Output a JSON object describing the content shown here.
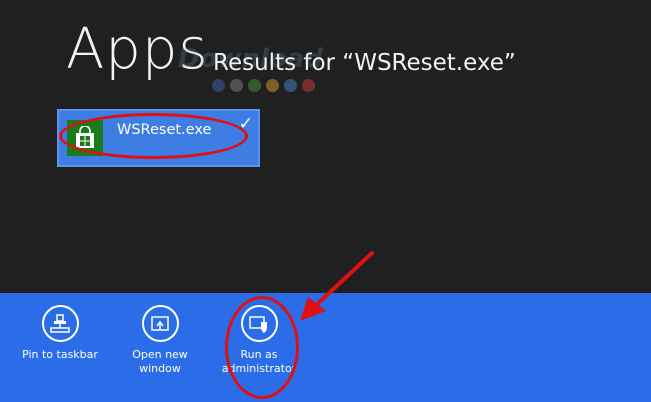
{
  "screen": {
    "heading": "Apps",
    "results_title": "Results for “WSReset.exe”"
  },
  "watermark": {
    "text": "Download",
    "dot_colors": [
      "#3b5ea8",
      "#7a7a7a",
      "#4b8b3b",
      "#c9962a",
      "#3b7fc9",
      "#c23b3b"
    ]
  },
  "results": [
    {
      "label": "WSReset.exe",
      "icon": "store-icon",
      "selected": true
    }
  ],
  "appbar": {
    "buttons": [
      {
        "label": "Pin to taskbar",
        "icon": "pin-taskbar-icon"
      },
      {
        "label": "Open new\nwindow",
        "icon": "open-new-window-icon"
      },
      {
        "label": "Run as\nadministrator",
        "icon": "run-as-admin-shield-icon"
      }
    ]
  },
  "colors": {
    "background": "#202020",
    "tile": "#3e7de3",
    "appbar": "#2b6de8",
    "annotation": "#e01010",
    "store_icon": "#1b7a1b"
  }
}
